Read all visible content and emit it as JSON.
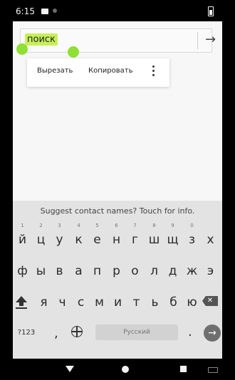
{
  "status": {
    "time": "6:15"
  },
  "search": {
    "query": "поиск"
  },
  "context_menu": {
    "cut": "Вырезать",
    "copy": "Копировать"
  },
  "keyboard": {
    "suggestion": "Suggest contact names? Touch for info.",
    "row1": [
      {
        "char": "й",
        "num": "1"
      },
      {
        "char": "ц",
        "num": "2"
      },
      {
        "char": "у",
        "num": "3"
      },
      {
        "char": "к",
        "num": "4"
      },
      {
        "char": "е",
        "num": "5"
      },
      {
        "char": "н",
        "num": "6"
      },
      {
        "char": "г",
        "num": "7"
      },
      {
        "char": "ш",
        "num": "8"
      },
      {
        "char": "щ",
        "num": "9"
      },
      {
        "char": "з",
        "num": "0"
      },
      {
        "char": "х",
        "num": ""
      }
    ],
    "row2": [
      "ф",
      "ы",
      "в",
      "а",
      "п",
      "р",
      "о",
      "л",
      "д",
      "ж",
      "э"
    ],
    "row3": [
      "я",
      "ч",
      "с",
      "м",
      "и",
      "т",
      "ь",
      "б",
      "ю"
    ],
    "symbols_label": "?123",
    "comma": ",",
    "space_label": "Русский",
    "period": "."
  }
}
